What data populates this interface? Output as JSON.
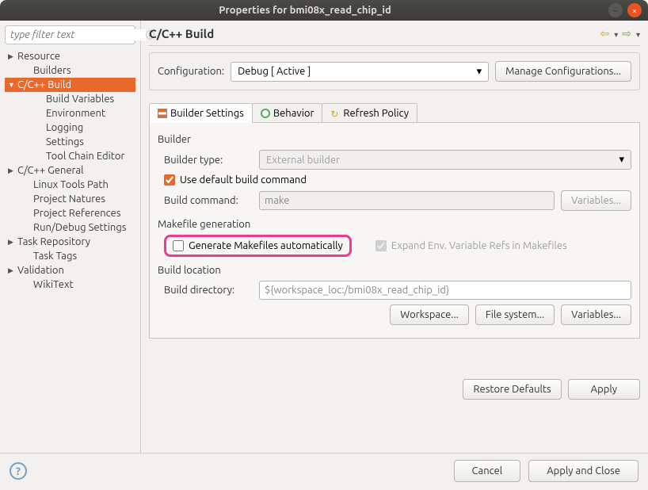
{
  "window": {
    "title": "Properties for bmi08x_read_chip_id"
  },
  "filter": {
    "placeholder": "type filter text"
  },
  "tree": [
    {
      "label": "Resource",
      "expandable": true,
      "level": 0
    },
    {
      "label": "Builders",
      "expandable": false,
      "level": 1
    },
    {
      "label": "C/C++ Build",
      "expandable": true,
      "level": 0,
      "open": true,
      "selected": true
    },
    {
      "label": "Build Variables",
      "level": 2
    },
    {
      "label": "Environment",
      "level": 2
    },
    {
      "label": "Logging",
      "level": 2
    },
    {
      "label": "Settings",
      "level": 2
    },
    {
      "label": "Tool Chain Editor",
      "level": 2
    },
    {
      "label": "C/C++ General",
      "expandable": true,
      "level": 0
    },
    {
      "label": "Linux Tools Path",
      "level": 1
    },
    {
      "label": "Project Natures",
      "level": 1
    },
    {
      "label": "Project References",
      "level": 1
    },
    {
      "label": "Run/Debug Settings",
      "level": 1
    },
    {
      "label": "Task Repository",
      "expandable": true,
      "level": 0
    },
    {
      "label": "Task Tags",
      "level": 1
    },
    {
      "label": "Validation",
      "expandable": true,
      "level": 0
    },
    {
      "label": "WikiText",
      "level": 1
    }
  ],
  "main": {
    "title": "C/C++ Build",
    "configuration_label": "Configuration:",
    "configuration_value": "Debug  [ Active ]",
    "manage_config": "Manage Configurations...",
    "tabs": {
      "builder_settings": "Builder Settings",
      "behavior": "Behavior",
      "refresh_policy": "Refresh Policy"
    },
    "builder": {
      "legend": "Builder",
      "type_label": "Builder type:",
      "type_value": "External builder",
      "use_default": "Use default build command",
      "command_label": "Build command:",
      "command_value": "make",
      "variables_btn": "Variables..."
    },
    "makefile": {
      "legend": "Makefile generation",
      "generate": "Generate Makefiles automatically",
      "expand": "Expand Env. Variable Refs in Makefiles"
    },
    "location": {
      "legend": "Build location",
      "dir_label": "Build directory:",
      "dir_value": "${workspace_loc:/bmi08x_read_chip_id}",
      "workspace_btn": "Workspace...",
      "filesystem_btn": "File system...",
      "variables_btn": "Variables..."
    },
    "restore": "Restore Defaults",
    "apply": "Apply"
  },
  "footer": {
    "cancel": "Cancel",
    "apply_close": "Apply and Close"
  }
}
